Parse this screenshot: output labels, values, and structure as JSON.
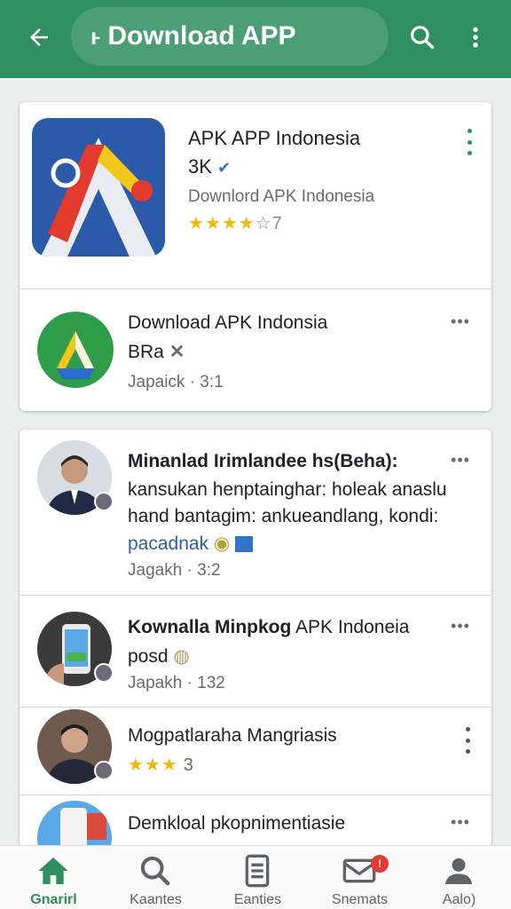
{
  "appbar": {
    "prefix": "ⱶ",
    "title": "Download APP",
    "color": "#2f8f5e"
  },
  "featured": {
    "title": "APK APP Indonesia",
    "count": "3K",
    "subtitle": "Downlord APK Indonesia",
    "rating_stars": "★★★★",
    "rating_tail": "☆7"
  },
  "app_item": {
    "title": "Download APK Indonsia",
    "subtitle": "BRa",
    "meta": "Japaick · 3:1"
  },
  "feed": [
    {
      "title": "Minanlad Irimlandee hs(Beha):",
      "line2": "kansukan henptainghar: holeak anaslu",
      "line3": "hand bantagim: ankueandlang, kondi:",
      "line4": "pacadnak",
      "meta": "Jagakh · 3:2"
    },
    {
      "title": "Kownalla Minpkog",
      "title_rest": "APK Indoneia",
      "line2": "posd",
      "meta": "Japakh · 132"
    },
    {
      "title": "Mogpatlaraha Mangriasis",
      "rating_stars": "★★★",
      "rating_tail": "3"
    },
    {
      "title": "Demkloal pkopnimentiasie"
    }
  ],
  "bottom_nav": [
    {
      "label": "Gnarirl",
      "icon": "home-icon"
    },
    {
      "label": "Kaantes",
      "icon": "search-icon"
    },
    {
      "label": "Eanties",
      "icon": "list-icon"
    },
    {
      "label": "Snemats",
      "icon": "mail-icon"
    },
    {
      "label": "Aalo)",
      "icon": "person-icon"
    }
  ],
  "colors": {
    "brand": "#2f8f5e",
    "star": "#f2b90d",
    "notification": "#e53935"
  }
}
